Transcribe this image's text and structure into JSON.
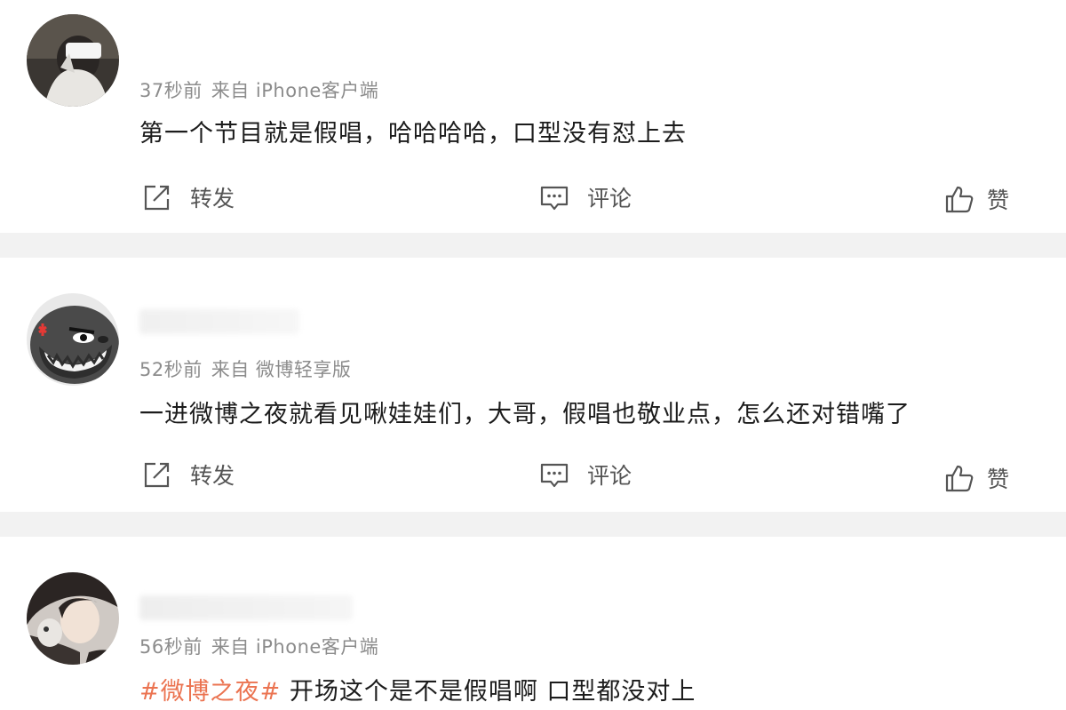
{
  "actions": {
    "repost": "转发",
    "comment": "评论",
    "like": "赞"
  },
  "posts": [
    {
      "time": "37秒前",
      "source": "来自 iPhone客户端",
      "content": "第一个节目就是假唱，哈哈哈哈，口型没有怼上去"
    },
    {
      "time": "52秒前",
      "source": "来自 微博轻享版",
      "content": "一进微博之夜就看见啾娃娃们，大哥，假唱也敬业点，怎么还对错嘴了"
    },
    {
      "time": "56秒前",
      "source": "来自 iPhone客户端",
      "topic": "#微博之夜#",
      "content": " 开场这个是不是假唱啊 口型都没对上"
    }
  ],
  "colors": {
    "topic": "#eb7350",
    "meta": "#8c8c8c",
    "separator": "#f2f2f2"
  }
}
